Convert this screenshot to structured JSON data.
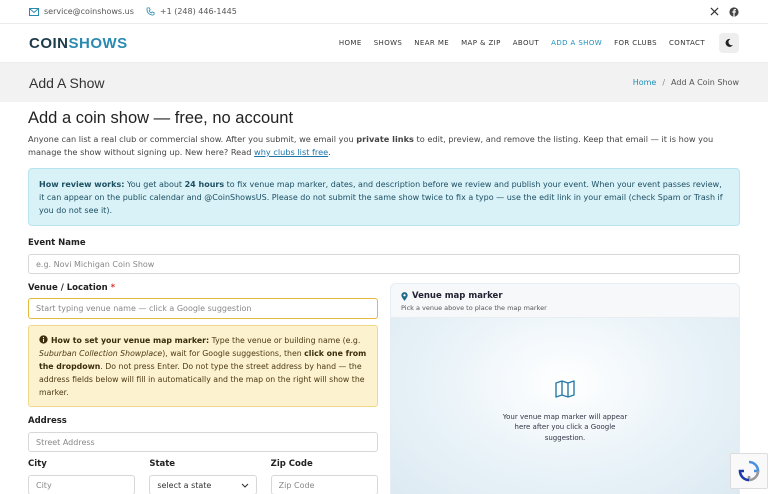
{
  "topbar": {
    "email": "service@coinshows.us",
    "phone": "+1 (248) 446-1445"
  },
  "brand": {
    "part1": "COIN",
    "part2": "SHOWS"
  },
  "nav": [
    "HOME",
    "SHOWS",
    "NEAR ME",
    "MAP & ZIP",
    "ABOUT",
    "ADD A SHOW",
    "FOR CLUBS",
    "CONTACT"
  ],
  "page": {
    "title": "Add A Show",
    "crumb_home": "Home",
    "crumb_sep": "/",
    "crumb_current": "Add A Coin Show"
  },
  "heading": "Add a coin show — free, no account",
  "intro": {
    "t1": "Anyone can list a real club or commercial show. After you submit, we email you ",
    "bold": "private links",
    "t2": " to edit, preview, and remove the listing. Keep that email — it is how you manage the show without signing up. New here? Read ",
    "link": "why clubs list free",
    "t3": "."
  },
  "review": {
    "label": "How review works:",
    "t1": " You get about ",
    "hours": "24 hours",
    "t2": " to fix venue map marker, dates, and description before we review and publish your event. When your event passes review, it can appear on the public calendar and @CoinShowsUS. Please do not submit the same show twice to fix a typo — use the edit link in your email (check Spam or Trash if you do not see it)."
  },
  "form": {
    "event_label": "Event Name",
    "event_placeholder": "e.g. Novi Michigan Coin Show",
    "venue_label": "Venue / Location",
    "venue_required": "*",
    "venue_placeholder": "Start typing venue name — click a Google suggestion",
    "tip": {
      "label": "How to set your venue map marker:",
      "t1": " Type the venue or building name (e.g. ",
      "example": "Suburban Collection Showplace",
      "t2": "), wait for Google suggestions, then ",
      "bold": "click one from the dropdown",
      "t3": ". Do not press Enter. Do not type the street address by hand — the address fields below will fill in automatically and the map on the right will show the marker."
    },
    "address_label": "Address",
    "address_placeholder": "Street Address",
    "city_label": "City",
    "city_placeholder": "City",
    "state_label": "State",
    "state_value": "select a state",
    "zip_label": "Zip Code",
    "zip_placeholder": "Zip Code"
  },
  "map": {
    "title": "Venue map marker",
    "subtitle": "Pick a venue above to place the map marker",
    "message": "Your venue map marker will appear here after you click a Google suggestion."
  },
  "colors": {
    "accent": "#1c8fb8",
    "brand_dark": "#1d3a4a",
    "info_bg": "#d8f2f8",
    "warn_bg": "#fdf2cf"
  }
}
